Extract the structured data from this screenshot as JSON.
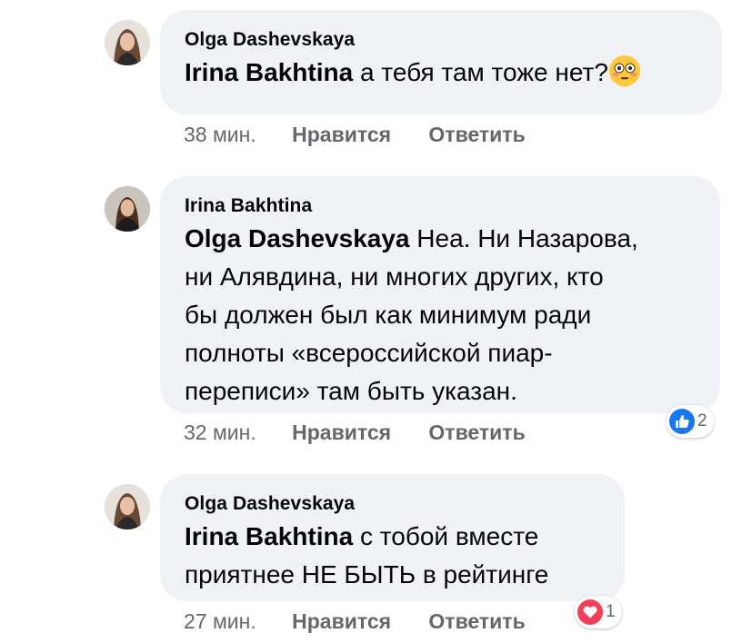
{
  "comments": [
    {
      "author": "Olga Dashevskaya",
      "mention": "Irina Bakhtina",
      "text_lines": [
        "а тебя там тоже нет?"
      ],
      "emoji": "flushed-face-emoji",
      "time": "38 мин.",
      "like_label": "Нравится",
      "reply_label": "Ответить",
      "reaction": null
    },
    {
      "author": "Irina Bakhtina",
      "mention": "Olga Dashevskaya",
      "text_lines": [
        "Неа. Ни Назарова,",
        "ни Алявдина, ни многих других, кто",
        "бы должен был как минимум ради",
        "полноты «всероссийской пиар-",
        "переписи» там быть указан."
      ],
      "time": "32 мин.",
      "like_label": "Нравится",
      "reply_label": "Ответить",
      "reaction": {
        "icon": "like-icon",
        "count": "2",
        "color": "#1877f2"
      }
    },
    {
      "author": "Olga Dashevskaya",
      "mention": "Irina Bakhtina",
      "text_lines": [
        "с тобой вместе",
        "приятнее НЕ БЫТЬ в рейтинге"
      ],
      "time": "27 мин.",
      "like_label": "Нравится",
      "reply_label": "Ответить",
      "reaction": {
        "icon": "heart-icon",
        "count": "1",
        "color": "#f33e58"
      }
    }
  ],
  "colors": {
    "bubble": "#f0f2f5",
    "meta_text": "#65676b",
    "like_blue": "#1877f2",
    "love_red": "#f33e58"
  }
}
